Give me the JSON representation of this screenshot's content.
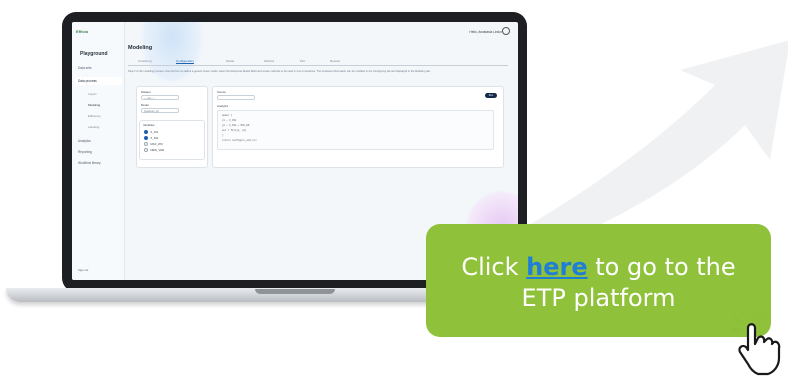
{
  "app": {
    "logo_text": "Efficio",
    "user_label": "Hello, Anastasia Lindor"
  },
  "sidebar": {
    "title": "Playground",
    "items": [
      {
        "label": "Data sets"
      },
      {
        "label": "Data process"
      },
      {
        "label": "Analytics"
      },
      {
        "label": "Reporting"
      },
      {
        "label": "Workflow library"
      }
    ],
    "sub_items": [
      {
        "label": "Import"
      },
      {
        "label": "Modeling"
      },
      {
        "label": "Efficiency"
      },
      {
        "label": "Labeling"
      }
    ],
    "footer": "Sign out"
  },
  "page": {
    "title": "Modeling",
    "tabs": [
      {
        "label": "Clustering"
      },
      {
        "label": "Configuration"
      },
      {
        "label": "Model"
      },
      {
        "label": "Method"
      },
      {
        "label": "Plot"
      },
      {
        "label": "Results"
      }
    ],
    "description": "Step 2 of the modeling process. Use this form to define a generic linear model, select the Response Model Build and create methods to be used in one or iterations. The produced information can be modified in the Configuring tab and displayed in the Modeling tab."
  },
  "left_card": {
    "dataset_label": "Dataset",
    "dataset_value": "— any —",
    "model_label": "Model",
    "model_value": "Quantum_lin",
    "panel_title": "Variables",
    "options": [
      {
        "label": "X_IN1",
        "checked": true
      },
      {
        "label": "X_IN2",
        "checked": true
      },
      {
        "label": "MAX_WO",
        "checked": false
      },
      {
        "label": "NEW_VAR",
        "checked": false
      }
    ]
  },
  "right_card": {
    "title": "Source",
    "run_label": "Run",
    "input_label": "Analytics",
    "code_lines": [
      "model {",
      "  y1 ~ X_IN1",
      "  y2 ~ X_IN2 + MAX_WO",
      "  out = fit(y1, y2)",
      "}",
      "return configure_and_run"
    ]
  },
  "cta": {
    "prefix": "Click ",
    "link_text": "here",
    "suffix_line1": " to go to the",
    "line2": "ETP platform",
    "color": "#8fc23a",
    "link_color": "#1f7fd6"
  }
}
